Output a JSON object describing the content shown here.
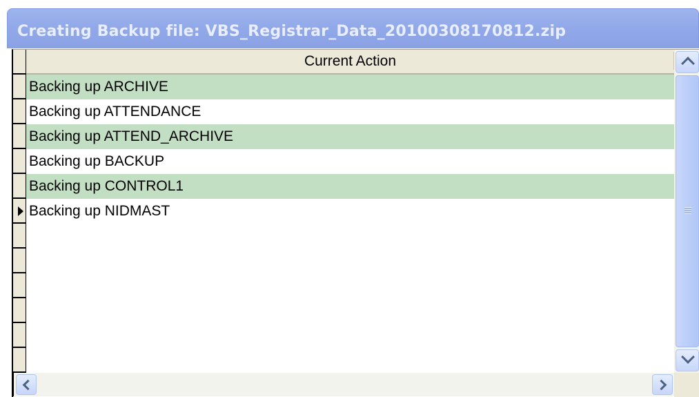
{
  "window": {
    "title": "Creating Backup file:  VBS_Registrar_Data_20100308170812.zip"
  },
  "grid": {
    "column_header": "Current Action",
    "current_row_index": 5,
    "rows": [
      "Backing up ARCHIVE",
      "Backing up ATTENDANCE",
      "Backing up ATTEND_ARCHIVE",
      "Backing up BACKUP",
      "Backing up CONTROL1",
      "Backing up NIDMAST"
    ]
  },
  "icons": {
    "record_pointer": "record-pointer-icon",
    "scroll_up": "chevron-up-icon",
    "scroll_down": "chevron-down-icon",
    "scroll_left": "chevron-left-icon",
    "scroll_right": "chevron-right-icon"
  },
  "colors": {
    "title_bar": "#9eb4ee",
    "title_text": "#e8eeff",
    "alternate_row": "#c3dfc3",
    "header_bg": "#ece9d8"
  }
}
